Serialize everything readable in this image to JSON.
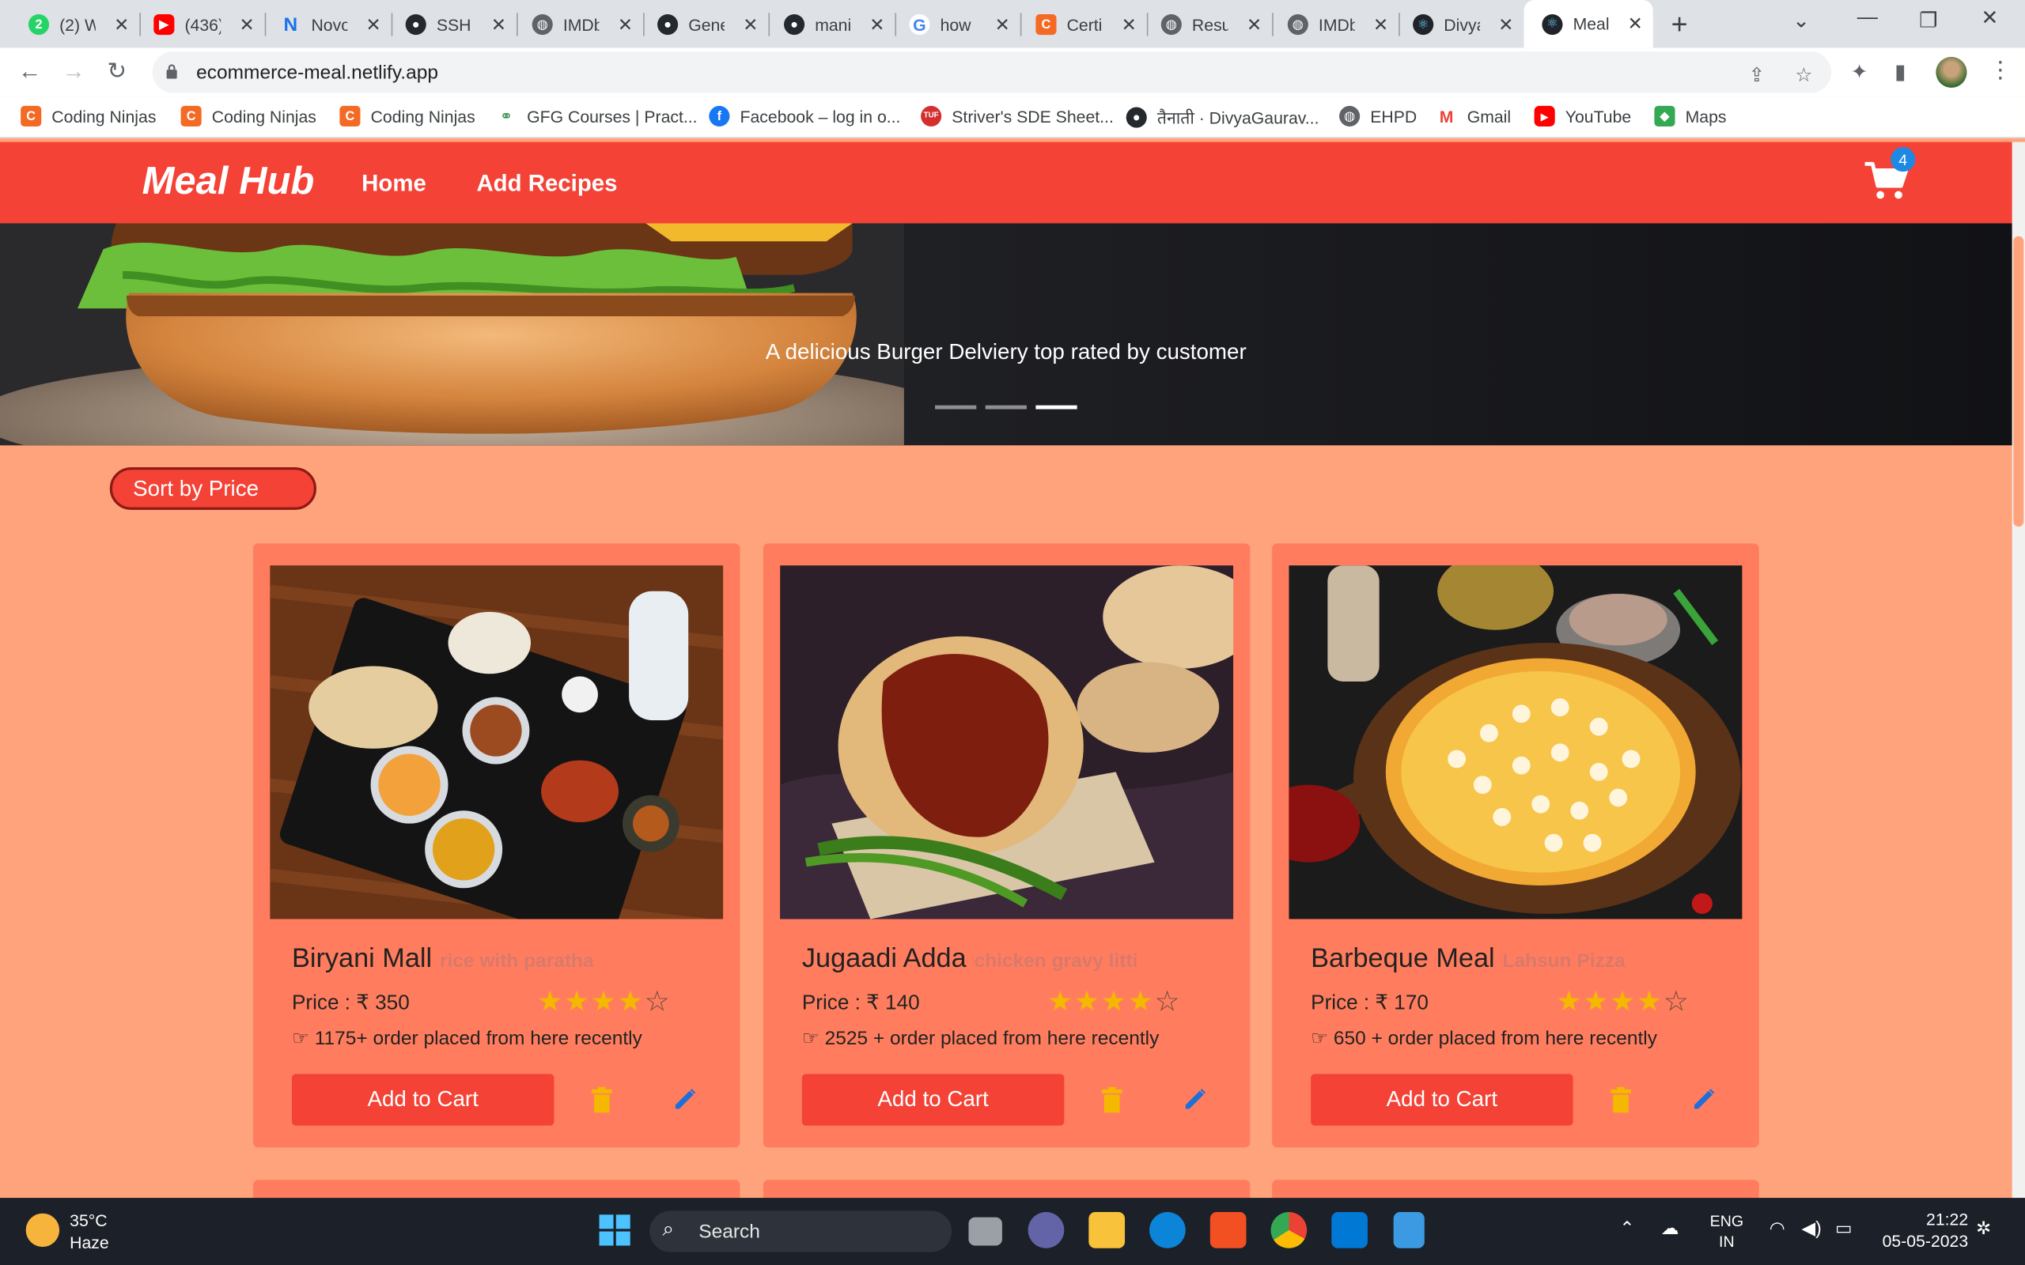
{
  "browser": {
    "tabs": [
      {
        "title": "(2) W",
        "icon": "whatsapp-icon",
        "color": "#25d366"
      },
      {
        "title": "(436)",
        "icon": "youtube-icon",
        "color": "#ff0000"
      },
      {
        "title": "Novo",
        "icon": "novo-icon",
        "color": "#1a73e8"
      },
      {
        "title": "SSH",
        "icon": "github-icon",
        "color": "#24292f"
      },
      {
        "title": "IMDb",
        "icon": "globe-icon",
        "color": "#5f6368"
      },
      {
        "title": "Gene",
        "icon": "github-icon",
        "color": "#24292f"
      },
      {
        "title": "mani",
        "icon": "github-icon",
        "color": "#24292f"
      },
      {
        "title": "how",
        "icon": "google-icon",
        "color": "#4285f4"
      },
      {
        "title": "Certi",
        "icon": "coding-ninjas-icon",
        "color": "#f46a25"
      },
      {
        "title": "Resu",
        "icon": "globe-icon",
        "color": "#5f6368"
      },
      {
        "title": "IMDb",
        "icon": "globe-icon",
        "color": "#5f6368"
      },
      {
        "title": "Divya",
        "icon": "react-icon",
        "color": "#61dafb"
      },
      {
        "title": "Meal",
        "icon": "react-icon",
        "color": "#61dafb"
      }
    ],
    "url": "ecommerce-meal.netlify.app",
    "bookmarks": [
      {
        "label": "Coding Ninjas",
        "color": "#f46a25"
      },
      {
        "label": "Coding Ninjas",
        "color": "#f46a25"
      },
      {
        "label": "Coding Ninjas",
        "color": "#f46a25"
      },
      {
        "label": "GFG Courses | Pract...",
        "color": "#2f8d46"
      },
      {
        "label": "Facebook – log in o...",
        "color": "#1877f2"
      },
      {
        "label": "Striver's SDE Sheet...",
        "color": "#d32f2f"
      },
      {
        "label": "तैनाती · DivyaGaurav...",
        "color": "#24292f"
      },
      {
        "label": "EHPD",
        "color": "#5f6368"
      },
      {
        "label": "Gmail",
        "color": "#ea4335"
      },
      {
        "label": "YouTube",
        "color": "#ff0000"
      },
      {
        "label": "Maps",
        "color": "#34a853"
      }
    ]
  },
  "app": {
    "brand": "Meal Hub",
    "nav": {
      "home": "Home",
      "add": "Add Recipes"
    },
    "cart_count": "4",
    "hero_caption": "A delicious Burger Delviery top rated by customer",
    "sort_label": "Sort by Price",
    "cards": [
      {
        "name": "Biryani Mall",
        "sub": "rice with paratha",
        "price": "Price : ₹ 350",
        "rating": 4,
        "orders": "☞ 1175+ order placed from here recently",
        "add": "Add to Cart"
      },
      {
        "name": "Jugaadi Adda",
        "sub": "chicken gravy litti",
        "price": "Price : ₹ 140",
        "rating": 4,
        "orders": "☞ 2525 + order placed from here recently",
        "add": "Add to Cart"
      },
      {
        "name": "Barbeque Meal",
        "sub": "Lahsun Pizza",
        "price": "Price : ₹ 170",
        "rating": 4,
        "orders": "☞ 650 + order placed from here recently",
        "add": "Add to Cart"
      }
    ],
    "colors": {
      "primary": "#f44236",
      "page_bg": "#ffa37c",
      "card_bg": "#ff7d5e",
      "star": "#f5b800",
      "edit": "#1e6fd9",
      "delete": "#f5b800"
    }
  },
  "taskbar": {
    "temp": "35°C",
    "condition": "Haze",
    "search": "Search",
    "lang1": "ENG",
    "lang2": "IN",
    "time": "21:22",
    "date": "05-05-2023"
  }
}
